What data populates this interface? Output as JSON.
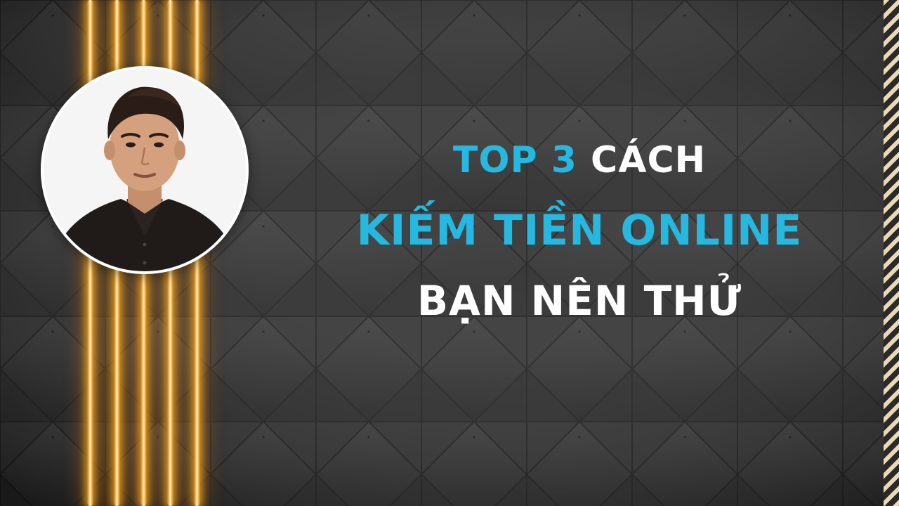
{
  "headline": {
    "line1_accent": "TOP 3",
    "line1_rest": " CÁCH",
    "line2": "KIẾM TIỀN ONLINE",
    "line3": "BẠN NÊN THỬ"
  },
  "colors": {
    "accent": "#25b8e0",
    "text": "#ffffff",
    "background": "#2e2e2e",
    "neon": "#ffcf5a",
    "stripe": "#ead9b3"
  },
  "icons": {
    "avatar": "person-photo",
    "neon_lights": "neon-bars",
    "edge": "diagonal-stripes"
  }
}
